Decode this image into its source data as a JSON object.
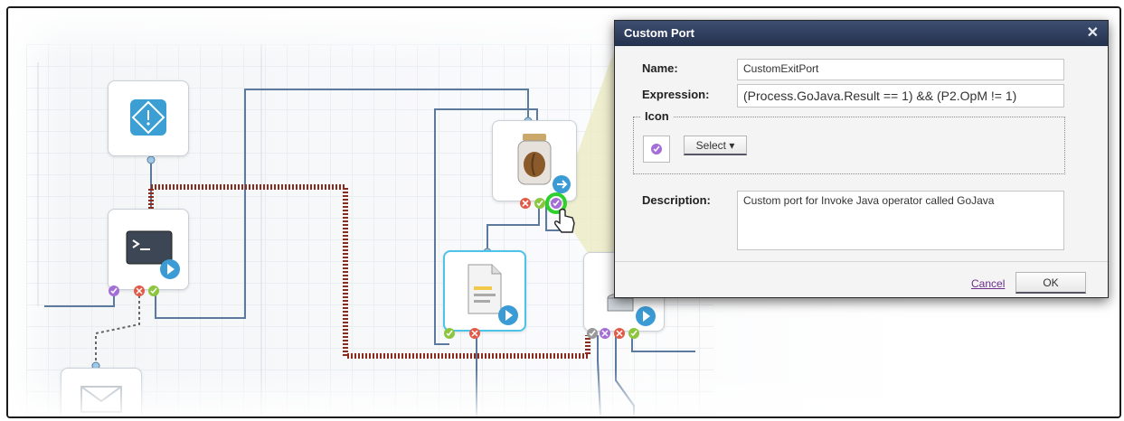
{
  "dialog": {
    "title": "Custom Port",
    "close_glyph": "✕",
    "name_label": "Name:",
    "name_value": "CustomExitPort",
    "expression_label": "Expression:",
    "expression_value": "(Process.GoJava.Result == 1) && (P2.OpM != 1)",
    "icon_section_label": "Icon",
    "icon_select_label": "Select ▾",
    "description_label": "Description:",
    "description_value": "Custom port for Invoke Java operator called GoJava",
    "cancel_label": "Cancel",
    "ok_label": "OK"
  },
  "canvas": {
    "nodes": [
      "start-node",
      "terminal-node",
      "java-jar-node",
      "document-node",
      "database-node",
      "email-node"
    ],
    "port_colors": {
      "success": "#8cc63f",
      "failure": "#e05a47",
      "custom": "#a36ed6",
      "play": "#3b9bd4"
    }
  },
  "icons": [
    "start-icon",
    "terminal-icon",
    "jar-icon",
    "document-icon",
    "database-icon",
    "email-icon",
    "play-icon",
    "hand-cursor-icon",
    "purple-circle-icon",
    "close-icon"
  ]
}
